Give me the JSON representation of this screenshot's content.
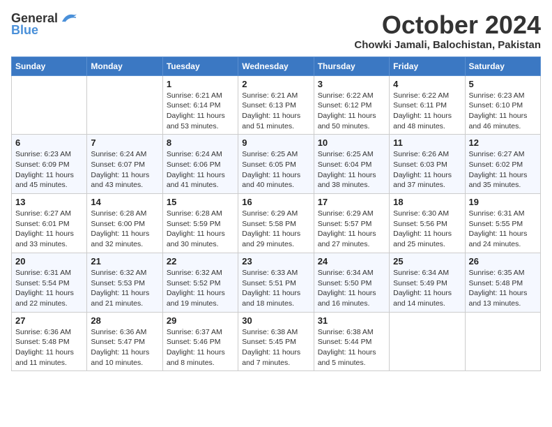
{
  "logo": {
    "general": "General",
    "blue": "Blue"
  },
  "title": "October 2024",
  "subtitle": "Chowki Jamali, Balochistan, Pakistan",
  "days_of_week": [
    "Sunday",
    "Monday",
    "Tuesday",
    "Wednesday",
    "Thursday",
    "Friday",
    "Saturday"
  ],
  "weeks": [
    [
      {
        "day": "",
        "detail": ""
      },
      {
        "day": "",
        "detail": ""
      },
      {
        "day": "1",
        "detail": "Sunrise: 6:21 AM\nSunset: 6:14 PM\nDaylight: 11 hours and 53 minutes."
      },
      {
        "day": "2",
        "detail": "Sunrise: 6:21 AM\nSunset: 6:13 PM\nDaylight: 11 hours and 51 minutes."
      },
      {
        "day": "3",
        "detail": "Sunrise: 6:22 AM\nSunset: 6:12 PM\nDaylight: 11 hours and 50 minutes."
      },
      {
        "day": "4",
        "detail": "Sunrise: 6:22 AM\nSunset: 6:11 PM\nDaylight: 11 hours and 48 minutes."
      },
      {
        "day": "5",
        "detail": "Sunrise: 6:23 AM\nSunset: 6:10 PM\nDaylight: 11 hours and 46 minutes."
      }
    ],
    [
      {
        "day": "6",
        "detail": "Sunrise: 6:23 AM\nSunset: 6:09 PM\nDaylight: 11 hours and 45 minutes."
      },
      {
        "day": "7",
        "detail": "Sunrise: 6:24 AM\nSunset: 6:07 PM\nDaylight: 11 hours and 43 minutes."
      },
      {
        "day": "8",
        "detail": "Sunrise: 6:24 AM\nSunset: 6:06 PM\nDaylight: 11 hours and 41 minutes."
      },
      {
        "day": "9",
        "detail": "Sunrise: 6:25 AM\nSunset: 6:05 PM\nDaylight: 11 hours and 40 minutes."
      },
      {
        "day": "10",
        "detail": "Sunrise: 6:25 AM\nSunset: 6:04 PM\nDaylight: 11 hours and 38 minutes."
      },
      {
        "day": "11",
        "detail": "Sunrise: 6:26 AM\nSunset: 6:03 PM\nDaylight: 11 hours and 37 minutes."
      },
      {
        "day": "12",
        "detail": "Sunrise: 6:27 AM\nSunset: 6:02 PM\nDaylight: 11 hours and 35 minutes."
      }
    ],
    [
      {
        "day": "13",
        "detail": "Sunrise: 6:27 AM\nSunset: 6:01 PM\nDaylight: 11 hours and 33 minutes."
      },
      {
        "day": "14",
        "detail": "Sunrise: 6:28 AM\nSunset: 6:00 PM\nDaylight: 11 hours and 32 minutes."
      },
      {
        "day": "15",
        "detail": "Sunrise: 6:28 AM\nSunset: 5:59 PM\nDaylight: 11 hours and 30 minutes."
      },
      {
        "day": "16",
        "detail": "Sunrise: 6:29 AM\nSunset: 5:58 PM\nDaylight: 11 hours and 29 minutes."
      },
      {
        "day": "17",
        "detail": "Sunrise: 6:29 AM\nSunset: 5:57 PM\nDaylight: 11 hours and 27 minutes."
      },
      {
        "day": "18",
        "detail": "Sunrise: 6:30 AM\nSunset: 5:56 PM\nDaylight: 11 hours and 25 minutes."
      },
      {
        "day": "19",
        "detail": "Sunrise: 6:31 AM\nSunset: 5:55 PM\nDaylight: 11 hours and 24 minutes."
      }
    ],
    [
      {
        "day": "20",
        "detail": "Sunrise: 6:31 AM\nSunset: 5:54 PM\nDaylight: 11 hours and 22 minutes."
      },
      {
        "day": "21",
        "detail": "Sunrise: 6:32 AM\nSunset: 5:53 PM\nDaylight: 11 hours and 21 minutes."
      },
      {
        "day": "22",
        "detail": "Sunrise: 6:32 AM\nSunset: 5:52 PM\nDaylight: 11 hours and 19 minutes."
      },
      {
        "day": "23",
        "detail": "Sunrise: 6:33 AM\nSunset: 5:51 PM\nDaylight: 11 hours and 18 minutes."
      },
      {
        "day": "24",
        "detail": "Sunrise: 6:34 AM\nSunset: 5:50 PM\nDaylight: 11 hours and 16 minutes."
      },
      {
        "day": "25",
        "detail": "Sunrise: 6:34 AM\nSunset: 5:49 PM\nDaylight: 11 hours and 14 minutes."
      },
      {
        "day": "26",
        "detail": "Sunrise: 6:35 AM\nSunset: 5:48 PM\nDaylight: 11 hours and 13 minutes."
      }
    ],
    [
      {
        "day": "27",
        "detail": "Sunrise: 6:36 AM\nSunset: 5:48 PM\nDaylight: 11 hours and 11 minutes."
      },
      {
        "day": "28",
        "detail": "Sunrise: 6:36 AM\nSunset: 5:47 PM\nDaylight: 11 hours and 10 minutes."
      },
      {
        "day": "29",
        "detail": "Sunrise: 6:37 AM\nSunset: 5:46 PM\nDaylight: 11 hours and 8 minutes."
      },
      {
        "day": "30",
        "detail": "Sunrise: 6:38 AM\nSunset: 5:45 PM\nDaylight: 11 hours and 7 minutes."
      },
      {
        "day": "31",
        "detail": "Sunrise: 6:38 AM\nSunset: 5:44 PM\nDaylight: 11 hours and 5 minutes."
      },
      {
        "day": "",
        "detail": ""
      },
      {
        "day": "",
        "detail": ""
      }
    ]
  ]
}
